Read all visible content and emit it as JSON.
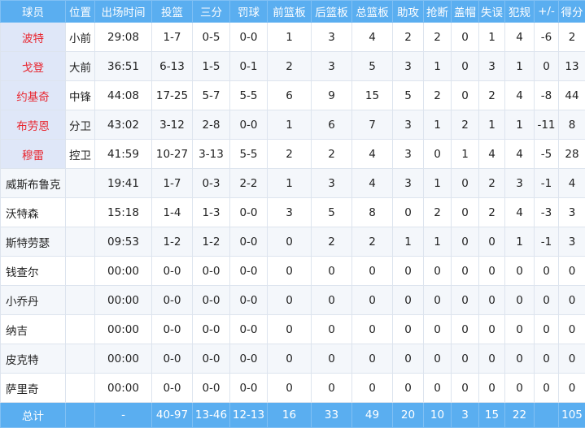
{
  "headers": {
    "player": "球员",
    "pos": "位置",
    "min": "出场时间",
    "fg": "投篮",
    "three": "三分",
    "ft": "罚球",
    "oreb": "前篮板",
    "dreb": "后篮板",
    "treb": "总篮板",
    "ast": "助攻",
    "stl": "抢断",
    "blk": "盖帽",
    "tov": "失误",
    "pf": "犯规",
    "pm": "+/-",
    "pts": "得分"
  },
  "rows": [
    {
      "name": "波特",
      "pos": "小前",
      "min": "29:08",
      "fg": "1-7",
      "three": "0-5",
      "ft": "0-0",
      "oreb": "1",
      "dreb": "3",
      "treb": "4",
      "ast": "2",
      "stl": "2",
      "blk": "0",
      "tov": "1",
      "pf": "4",
      "pm": "-6",
      "pts": "2"
    },
    {
      "name": "戈登",
      "pos": "大前",
      "min": "36:51",
      "fg": "6-13",
      "three": "1-5",
      "ft": "0-1",
      "oreb": "2",
      "dreb": "3",
      "treb": "5",
      "ast": "3",
      "stl": "1",
      "blk": "0",
      "tov": "3",
      "pf": "1",
      "pm": "0",
      "pts": "13"
    },
    {
      "name": "约基奇",
      "pos": "中锋",
      "min": "44:08",
      "fg": "17-25",
      "three": "5-7",
      "ft": "5-5",
      "oreb": "6",
      "dreb": "9",
      "treb": "15",
      "ast": "5",
      "stl": "2",
      "blk": "0",
      "tov": "2",
      "pf": "4",
      "pm": "-8",
      "pts": "44"
    },
    {
      "name": "布劳恩",
      "pos": "分卫",
      "min": "43:02",
      "fg": "3-12",
      "three": "2-8",
      "ft": "0-0",
      "oreb": "1",
      "dreb": "6",
      "treb": "7",
      "ast": "3",
      "stl": "1",
      "blk": "2",
      "tov": "1",
      "pf": "1",
      "pm": "-11",
      "pts": "8"
    },
    {
      "name": "穆雷",
      "pos": "控卫",
      "min": "41:59",
      "fg": "10-27",
      "three": "3-13",
      "ft": "5-5",
      "oreb": "2",
      "dreb": "2",
      "treb": "4",
      "ast": "3",
      "stl": "0",
      "blk": "1",
      "tov": "4",
      "pf": "4",
      "pm": "-5",
      "pts": "28"
    },
    {
      "name": "威斯布鲁克",
      "pos": "",
      "min": "19:41",
      "fg": "1-7",
      "three": "0-3",
      "ft": "2-2",
      "oreb": "1",
      "dreb": "3",
      "treb": "4",
      "ast": "3",
      "stl": "1",
      "blk": "0",
      "tov": "2",
      "pf": "3",
      "pm": "-1",
      "pts": "4"
    },
    {
      "name": "沃特森",
      "pos": "",
      "min": "15:18",
      "fg": "1-4",
      "three": "1-3",
      "ft": "0-0",
      "oreb": "3",
      "dreb": "5",
      "treb": "8",
      "ast": "0",
      "stl": "2",
      "blk": "0",
      "tov": "2",
      "pf": "4",
      "pm": "-3",
      "pts": "3"
    },
    {
      "name": "斯特劳瑟",
      "pos": "",
      "min": "09:53",
      "fg": "1-2",
      "three": "1-2",
      "ft": "0-0",
      "oreb": "0",
      "dreb": "2",
      "treb": "2",
      "ast": "1",
      "stl": "1",
      "blk": "0",
      "tov": "0",
      "pf": "1",
      "pm": "-1",
      "pts": "3"
    },
    {
      "name": "钱查尔",
      "pos": "",
      "min": "00:00",
      "fg": "0-0",
      "three": "0-0",
      "ft": "0-0",
      "oreb": "0",
      "dreb": "0",
      "treb": "0",
      "ast": "0",
      "stl": "0",
      "blk": "0",
      "tov": "0",
      "pf": "0",
      "pm": "0",
      "pts": "0"
    },
    {
      "name": "小乔丹",
      "pos": "",
      "min": "00:00",
      "fg": "0-0",
      "three": "0-0",
      "ft": "0-0",
      "oreb": "0",
      "dreb": "0",
      "treb": "0",
      "ast": "0",
      "stl": "0",
      "blk": "0",
      "tov": "0",
      "pf": "0",
      "pm": "0",
      "pts": "0"
    },
    {
      "name": "纳吉",
      "pos": "",
      "min": "00:00",
      "fg": "0-0",
      "three": "0-0",
      "ft": "0-0",
      "oreb": "0",
      "dreb": "0",
      "treb": "0",
      "ast": "0",
      "stl": "0",
      "blk": "0",
      "tov": "0",
      "pf": "0",
      "pm": "0",
      "pts": "0"
    },
    {
      "name": "皮克特",
      "pos": "",
      "min": "00:00",
      "fg": "0-0",
      "three": "0-0",
      "ft": "0-0",
      "oreb": "0",
      "dreb": "0",
      "treb": "0",
      "ast": "0",
      "stl": "0",
      "blk": "0",
      "tov": "0",
      "pf": "0",
      "pm": "0",
      "pts": "0"
    },
    {
      "name": "萨里奇",
      "pos": "",
      "min": "00:00",
      "fg": "0-0",
      "three": "0-0",
      "ft": "0-0",
      "oreb": "0",
      "dreb": "0",
      "treb": "0",
      "ast": "0",
      "stl": "0",
      "blk": "0",
      "tov": "0",
      "pf": "0",
      "pm": "0",
      "pts": "0"
    }
  ],
  "totals": {
    "label": "总计",
    "min": "-",
    "fg": "40-97",
    "three": "13-46",
    "ft": "12-13",
    "oreb": "16",
    "dreb": "33",
    "treb": "49",
    "ast": "20",
    "stl": "10",
    "blk": "3",
    "tov": "15",
    "pf": "22",
    "pm": "",
    "pts": "105"
  },
  "colors": {
    "header_bg": "#5aaef0",
    "starter_name": "#e8262f",
    "starter_name_bg": "#dfe7f8"
  }
}
